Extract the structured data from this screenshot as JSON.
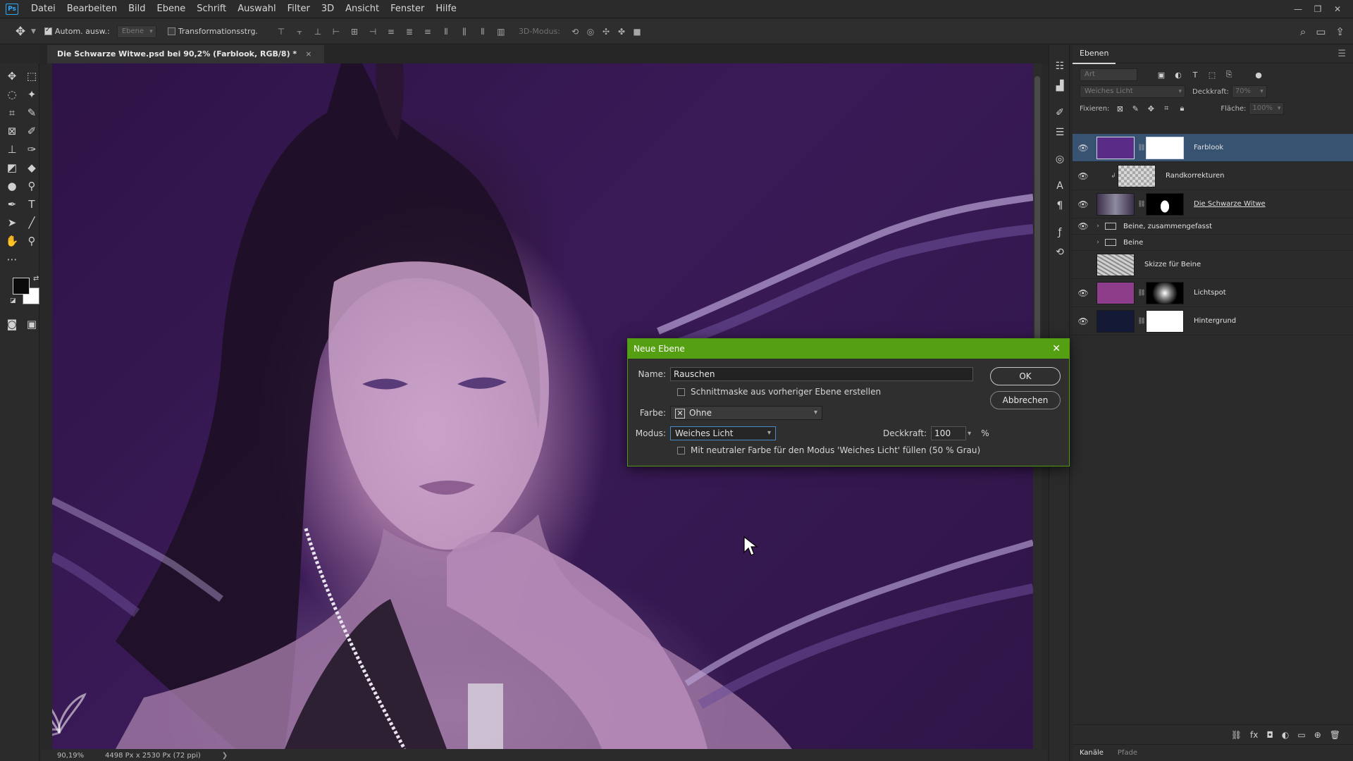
{
  "app": {
    "logo": "Ps"
  },
  "menu": [
    "Datei",
    "Bearbeiten",
    "Bild",
    "Ebene",
    "Schrift",
    "Auswahl",
    "Filter",
    "3D",
    "Ansicht",
    "Fenster",
    "Hilfe"
  ],
  "window_controls": {
    "minimize": "—",
    "restore": "❐",
    "close": "✕"
  },
  "options_bar": {
    "auto_select_label": "Autom. ausw.:",
    "auto_select_checked": true,
    "auto_select_target": "Ebene",
    "transform_controls_label": "Transformationsstrg.",
    "transform_controls_checked": false,
    "mode_3d_label": "3D-Modus:"
  },
  "document_tab": {
    "title": "Die Schwarze Witwe.psd bei 90,2% (Farblook, RGB/8) *",
    "close": "×"
  },
  "status_bar": {
    "zoom": "90,19%",
    "dimensions": "4498 Px x 2530 Px (72 ppi)",
    "arrow": "❯"
  },
  "layers_panel": {
    "title": "Ebenen",
    "filter_placeholder": "Art",
    "blend_mode": "Weiches Licht",
    "opacity_label": "Deckkraft:",
    "opacity_value": "70%",
    "lock_label": "Fixieren:",
    "fill_label": "Fläche:",
    "fill_value": "100%",
    "layers": [
      {
        "name": "Farblook",
        "visible": true,
        "selected": true
      },
      {
        "name": "Randkorrekturen",
        "visible": true
      },
      {
        "name": "Die Schwarze Witwe",
        "visible": true
      },
      {
        "name": "Beine, zusammengefasst",
        "visible": true,
        "group": true
      },
      {
        "name": "Beine",
        "visible": false,
        "group": true
      },
      {
        "name": "Skizze für Beine",
        "visible": false
      },
      {
        "name": "Lichtspot",
        "visible": true
      },
      {
        "name": "Hintergrund",
        "visible": true
      }
    ],
    "bottom_tabs": [
      "Kanäle",
      "Pfade"
    ]
  },
  "dialog": {
    "title": "Neue Ebene",
    "name_label": "Name:",
    "name_value": "Rauschen",
    "clip_label": "Schnittmaske aus vorheriger Ebene erstellen",
    "color_label": "Farbe:",
    "color_value": "Ohne",
    "mode_label": "Modus:",
    "mode_value": "Weiches Licht",
    "opacity_label": "Deckkraft:",
    "opacity_value": "100",
    "opacity_unit": "%",
    "neutral_fill_label": "Mit neutraler Farbe für den Modus 'Weiches Licht' füllen (50 % Grau)",
    "ok_label": "OK",
    "cancel_label": "Abbrechen"
  },
  "colors": {
    "dialog_title_bar": "#55a012",
    "selected_layer": "#385272",
    "foreground": "#0a0a0a",
    "background": "#ffffff"
  }
}
